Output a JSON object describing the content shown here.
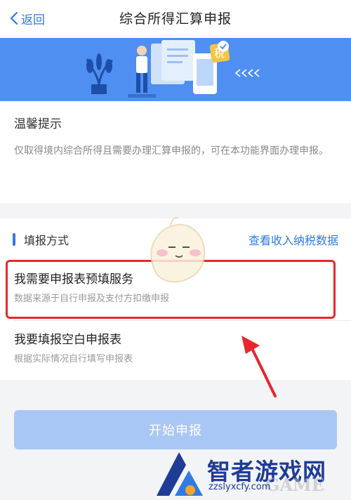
{
  "nav": {
    "back_label": "返回",
    "title": "综合所得汇算申报"
  },
  "banner": {
    "badge_char": "税"
  },
  "tip": {
    "title": "温馨提示",
    "text": "仅取得境内综合所得且需要办理汇算申报的，可在本功能界面办理申报。"
  },
  "method": {
    "section_label": "填报方式",
    "link_label": "查看收入纳税数据",
    "options": [
      {
        "title": "我需要申报表预填服务",
        "subtitle": "数据来源于自行申报及支付方扣缴申报"
      },
      {
        "title": "我要填报空白申报表",
        "subtitle": "根据实际情况自行填写申报表"
      }
    ]
  },
  "start_button": {
    "label": "开始申报"
  },
  "watermark": {
    "brand": "智者游戏网",
    "url": "zzslyxcfy.com",
    "game": "GAME"
  },
  "colors": {
    "accent": "#2f7ae5",
    "banner": "#4f8ff2",
    "highlight": "#e8262d",
    "button_disabled": "#a9c7f4"
  }
}
